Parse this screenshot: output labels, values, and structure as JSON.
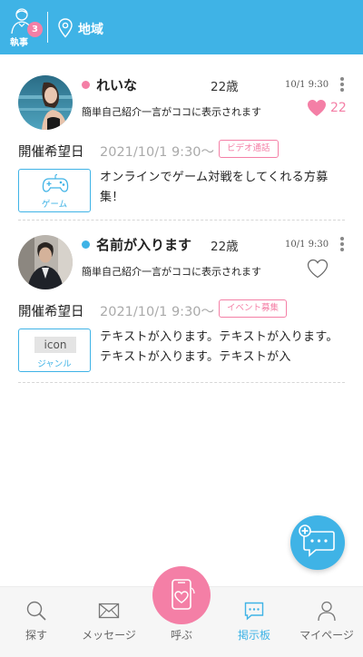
{
  "header": {
    "butler_label": "執事",
    "butler_badge": "3",
    "region_label": "地域",
    "background": "#3fb3e6",
    "butler_icon": "butler-icon",
    "region_icon": "location-pin-icon"
  },
  "posts": [
    {
      "name": "れいな",
      "age": "22歳",
      "status_color": "#f47fa6",
      "date": "10/1 9:30",
      "intro": "簡単自己紹介一言がココに表示されます",
      "likes": "22",
      "liked": true,
      "date_label": "開催希望日",
      "event_datetime": "2021/10/1 9:30〜",
      "tag": "ビデオ通話",
      "genre_label": "ゲーム",
      "genre_icon": "gamepad-icon",
      "body": "オンラインでゲーム対戦をしてくれる方募集！"
    },
    {
      "name": "名前が入ります",
      "age": "22歳",
      "status_color": "#3fb3e6",
      "date": "10/1 9:30",
      "intro": "簡単自己紹介一言がココに表示されます",
      "liked": false,
      "date_label": "開催希望日",
      "event_datetime": "2021/10/1 9:30〜",
      "tag": "イベント募集",
      "genre_placeholder": "icon",
      "genre_label": "ジャンル",
      "body": "テキストが入ります。テキストが入ります。テキストが入ります。テキストが入"
    }
  ],
  "fab": {
    "icon": "new-post-chat-icon",
    "color": "#3fb3e6"
  },
  "nav": {
    "items": [
      {
        "label": "探す",
        "icon": "search-icon"
      },
      {
        "label": "メッセージ",
        "icon": "envelope-icon"
      },
      {
        "label": "呼ぶ",
        "icon": "phone-heart-icon"
      },
      {
        "label": "掲示板",
        "icon": "board-chat-icon",
        "active": true
      },
      {
        "label": "マイページ",
        "icon": "person-icon"
      }
    ],
    "active_color": "#3fb3e6",
    "call_color": "#f47fa6"
  }
}
